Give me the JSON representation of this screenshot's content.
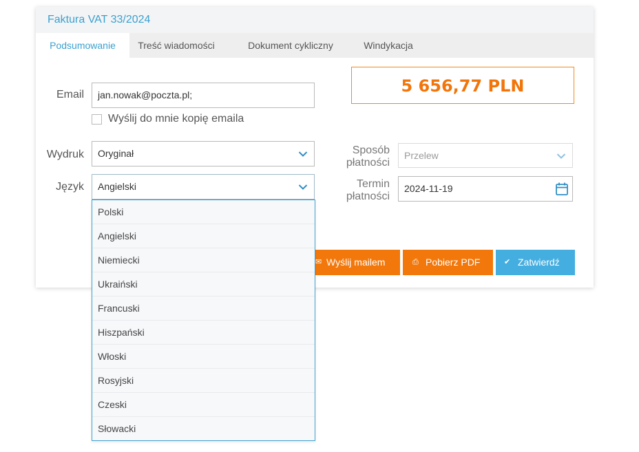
{
  "window": {
    "title": "Faktura VAT 33/2024"
  },
  "tabs": [
    {
      "label": "Podsumowanie",
      "active": true
    },
    {
      "label": "Treść wiadomości",
      "active": false
    },
    {
      "label": "Dokument cykliczny",
      "active": false
    },
    {
      "label": "Windykacja",
      "active": false
    }
  ],
  "form": {
    "email_label": "Email",
    "email_value": "jan.nowak@poczta.pl;",
    "copy_label": "Wyślij do mnie kopię emaila",
    "copy_checked": false,
    "print_label": "Wydruk",
    "print_value": "Oryginał",
    "language_label": "Język",
    "language_value": "Angielski",
    "payment_method_label_1": "Sposób",
    "payment_method_label_2": "płatności",
    "payment_method_value": "Przelew",
    "payment_due_label_1": "Termin",
    "payment_due_label_2": "płatności",
    "payment_due_value": "2024-11-19"
  },
  "total": {
    "amount": "5 656,77 PLN"
  },
  "actions": {
    "send_email_label": "Wyślij mailem",
    "download_pdf_label": "Pobierz PDF",
    "confirm_label": "Zatwierdź"
  },
  "language_dropdown": {
    "open": true,
    "options": [
      "Polski",
      "Angielski",
      "Niemiecki",
      "Ukraiński",
      "Francuski",
      "Hiszpański",
      "Włoski",
      "Rosyjski",
      "Czeski",
      "Słowacki"
    ]
  },
  "colors": {
    "accent_blue": "#3aa0cf",
    "accent_orange": "#f2780c",
    "confirm_blue": "#45aee0"
  },
  "icons": {
    "select_arrow": "chevron-down-icon",
    "date_picker": "calendar-icon",
    "send_email": "envelope-icon",
    "download_pdf": "printer-icon",
    "confirm": "checkmark-icon"
  }
}
